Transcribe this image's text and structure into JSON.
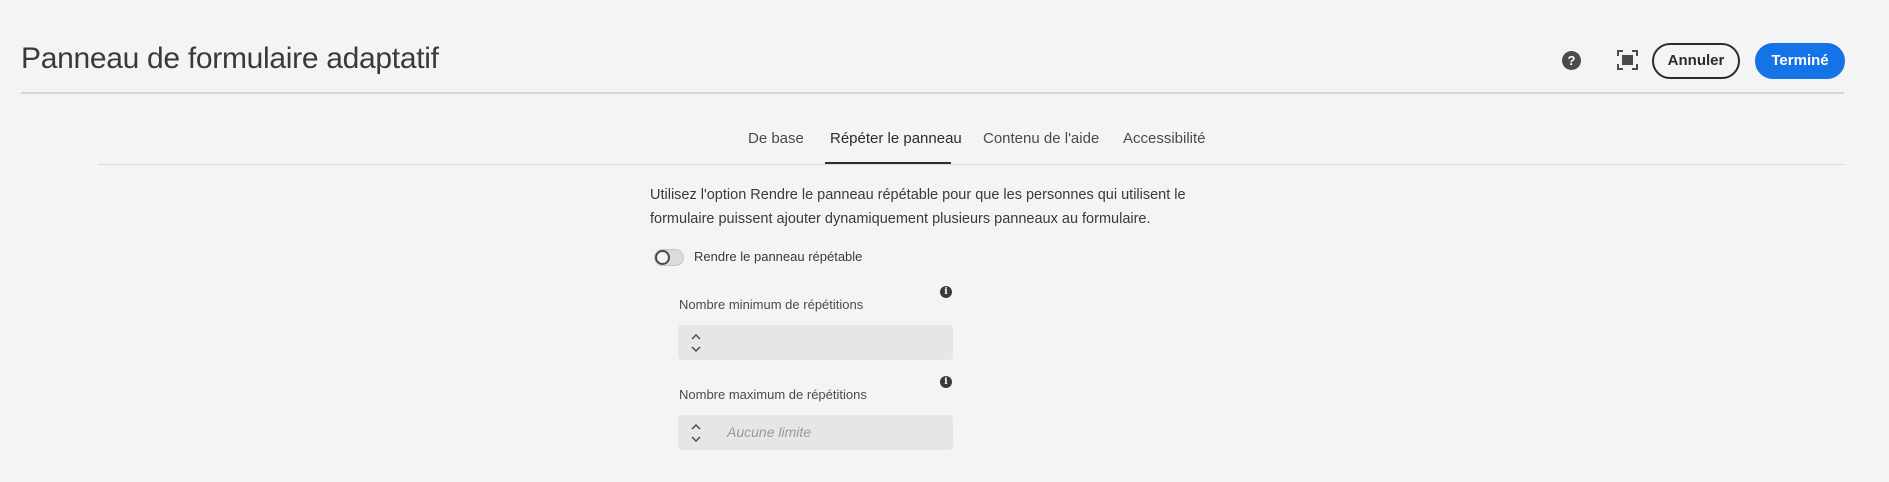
{
  "header": {
    "title": "Panneau de formulaire adaptatif",
    "help_icon": "help-icon",
    "fullscreen_icon": "fullscreen-icon",
    "cancel_label": "Annuler",
    "done_label": "Terminé",
    "accent_color": "#1473e6"
  },
  "tabs": [
    {
      "label": "De base",
      "active": false
    },
    {
      "label": "Répéter le panneau",
      "active": true
    },
    {
      "label": "Contenu de l'aide",
      "active": false
    },
    {
      "label": "Accessibilité",
      "active": false
    }
  ],
  "panel": {
    "description_line1": "Utilisez l'option Rendre le panneau répétable pour que les personnes qui utilisent le",
    "description_line2": "formulaire puissent ajouter dynamiquement plusieurs panneaux au formulaire.",
    "toggle": {
      "label": "Rendre le panneau répétable",
      "checked": false
    },
    "min_field": {
      "label": "Nombre minimum de répétitions",
      "value": "",
      "placeholder": ""
    },
    "max_field": {
      "label": "Nombre maximum de répétitions",
      "value": "",
      "placeholder": "Aucune limite"
    }
  }
}
